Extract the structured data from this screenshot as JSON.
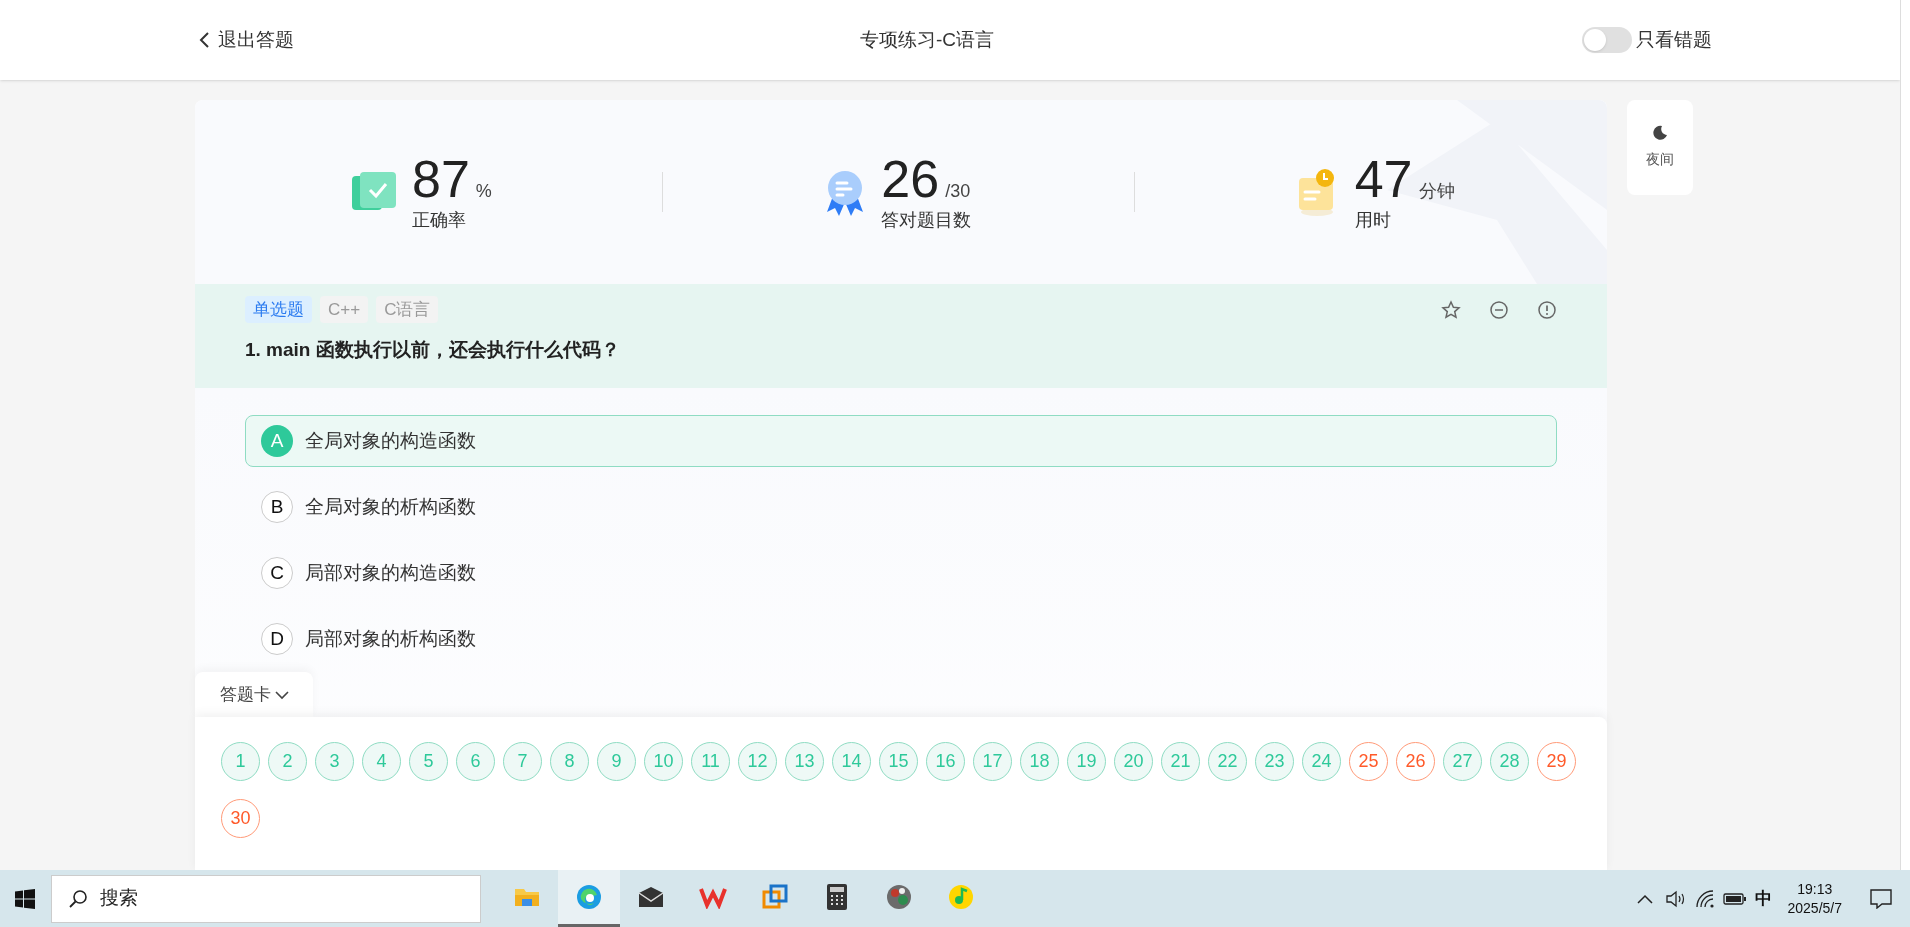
{
  "header": {
    "back": "退出答题",
    "title": "专项练习-C语言",
    "toggle": {
      "label": "只看错题",
      "on": false
    }
  },
  "night_button": "夜间",
  "stats": [
    {
      "kind": "accuracy",
      "value": "87",
      "unit": "%",
      "label": "正确率"
    },
    {
      "kind": "correct",
      "value": "26",
      "unit": "/30",
      "label": "答对题目数"
    },
    {
      "kind": "time",
      "value": "47",
      "unit": "分钟",
      "label": "用时"
    }
  ],
  "question": {
    "tags": [
      {
        "label": "单选题",
        "kind": "type"
      },
      {
        "label": "C++",
        "kind": "topic"
      },
      {
        "label": "C语言",
        "kind": "topic"
      }
    ],
    "text": "1. main 函数执行以前，还会执行什么代码？",
    "options": [
      {
        "letter": "A",
        "text": "全局对象的构造函数",
        "selected": true
      },
      {
        "letter": "B",
        "text": "全局对象的析构函数",
        "selected": false
      },
      {
        "letter": "C",
        "text": "局部对象的构造函数",
        "selected": false
      },
      {
        "letter": "D",
        "text": "局部对象的析构函数",
        "selected": false
      }
    ]
  },
  "answer_card": {
    "label": "答题卡",
    "expanded": true,
    "items": [
      {
        "n": "1",
        "wrong": false
      },
      {
        "n": "2",
        "wrong": false
      },
      {
        "n": "3",
        "wrong": false
      },
      {
        "n": "4",
        "wrong": false
      },
      {
        "n": "5",
        "wrong": false
      },
      {
        "n": "6",
        "wrong": false
      },
      {
        "n": "7",
        "wrong": false
      },
      {
        "n": "8",
        "wrong": false
      },
      {
        "n": "9",
        "wrong": false
      },
      {
        "n": "10",
        "wrong": false
      },
      {
        "n": "11",
        "wrong": false
      },
      {
        "n": "12",
        "wrong": false
      },
      {
        "n": "13",
        "wrong": false
      },
      {
        "n": "14",
        "wrong": false
      },
      {
        "n": "15",
        "wrong": false
      },
      {
        "n": "16",
        "wrong": false
      },
      {
        "n": "17",
        "wrong": false
      },
      {
        "n": "18",
        "wrong": false
      },
      {
        "n": "19",
        "wrong": false
      },
      {
        "n": "20",
        "wrong": false
      },
      {
        "n": "21",
        "wrong": false
      },
      {
        "n": "22",
        "wrong": false
      },
      {
        "n": "23",
        "wrong": false
      },
      {
        "n": "24",
        "wrong": false
      },
      {
        "n": "25",
        "wrong": true
      },
      {
        "n": "26",
        "wrong": true
      },
      {
        "n": "27",
        "wrong": false
      },
      {
        "n": "28",
        "wrong": false
      },
      {
        "n": "29",
        "wrong": true
      },
      {
        "n": "30",
        "wrong": true
      }
    ]
  },
  "taskbar": {
    "search": "搜索",
    "apps": [
      {
        "kind": "folder",
        "active": false
      },
      {
        "kind": "browser",
        "active": true
      },
      {
        "kind": "mail",
        "active": false
      },
      {
        "kind": "office",
        "active": false
      },
      {
        "kind": "squares",
        "active": false
      },
      {
        "kind": "calculator",
        "active": false
      },
      {
        "kind": "photo",
        "active": false
      },
      {
        "kind": "music",
        "active": false
      }
    ],
    "ime": "中",
    "time": "19:13",
    "date": "2025/5/7"
  }
}
